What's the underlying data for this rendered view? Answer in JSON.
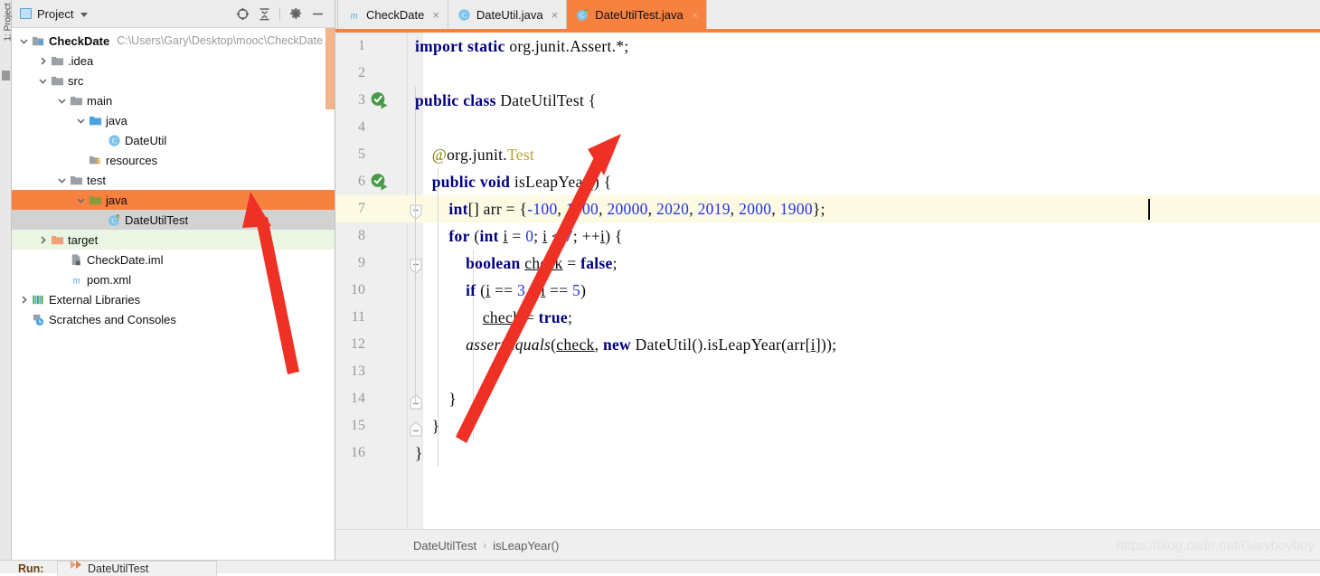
{
  "left_strip": {
    "label": "1: Project"
  },
  "project_panel": {
    "title": "Project",
    "actions": [
      {
        "name": "locate-icon",
        "label": ""
      },
      {
        "name": "collapse-all-icon",
        "label": ""
      },
      {
        "name": "settings-gear-icon",
        "label": ""
      },
      {
        "name": "hide-icon",
        "label": ""
      }
    ],
    "tree": [
      {
        "label": "CheckDate",
        "sub": "C:\\Users\\Gary\\Desktop\\mooc\\CheckDate",
        "depth": 0,
        "arrow": "down",
        "icon": "module-icon",
        "bold": true,
        "state": ""
      },
      {
        "label": ".idea",
        "sub": "",
        "depth": 1,
        "arrow": "right",
        "icon": "folder-gray-icon",
        "bold": false,
        "state": ""
      },
      {
        "label": "src",
        "sub": "",
        "depth": 1,
        "arrow": "down",
        "icon": "folder-gray-icon",
        "bold": false,
        "state": ""
      },
      {
        "label": "main",
        "sub": "",
        "depth": 2,
        "arrow": "down",
        "icon": "folder-gray-icon",
        "bold": false,
        "state": ""
      },
      {
        "label": "java",
        "sub": "",
        "depth": 3,
        "arrow": "down",
        "icon": "folder-blue-icon",
        "bold": false,
        "state": ""
      },
      {
        "label": "DateUtil",
        "sub": "",
        "depth": 4,
        "arrow": "none",
        "icon": "java-class-icon",
        "bold": false,
        "state": ""
      },
      {
        "label": "resources",
        "sub": "",
        "depth": 3,
        "arrow": "none",
        "icon": "folder-resources-icon",
        "bold": false,
        "state": ""
      },
      {
        "label": "test",
        "sub": "",
        "depth": 2,
        "arrow": "down",
        "icon": "folder-gray-icon",
        "bold": false,
        "state": ""
      },
      {
        "label": "java",
        "sub": "",
        "depth": 3,
        "arrow": "down",
        "icon": "folder-green-icon",
        "bold": false,
        "state": "selected-orange"
      },
      {
        "label": "DateUtilTest",
        "sub": "",
        "depth": 4,
        "arrow": "none",
        "icon": "java-test-class-icon",
        "bold": false,
        "state": "selected-gray"
      },
      {
        "label": "target",
        "sub": "",
        "depth": 1,
        "arrow": "right",
        "icon": "folder-orange-icon",
        "bold": false,
        "state": "tint-green"
      },
      {
        "label": "CheckDate.iml",
        "sub": "",
        "depth": 2,
        "arrow": "none",
        "icon": "iml-file-icon",
        "bold": false,
        "state": ""
      },
      {
        "label": "pom.xml",
        "sub": "",
        "depth": 2,
        "arrow": "none",
        "icon": "maven-icon",
        "bold": false,
        "state": ""
      },
      {
        "label": "External Libraries",
        "sub": "",
        "depth": 0,
        "arrow": "right",
        "icon": "libraries-icon",
        "bold": false,
        "state": ""
      },
      {
        "label": "Scratches and Consoles",
        "sub": "",
        "depth": 0,
        "arrow": "none",
        "icon": "scratches-icon",
        "bold": false,
        "state": ""
      }
    ]
  },
  "editor": {
    "tabs": [
      {
        "label": "CheckDate",
        "icon": "maven-icon",
        "active": false,
        "close": "×"
      },
      {
        "label": "DateUtil.java",
        "icon": "java-class-icon",
        "active": false,
        "close": "×"
      },
      {
        "label": "DateUtilTest.java",
        "icon": "java-test-class-icon",
        "active": true,
        "close": "×"
      }
    ],
    "lines": [
      {
        "n": "1",
        "indent": 0
      },
      {
        "n": "2",
        "indent": 0
      },
      {
        "n": "3",
        "indent": 0
      },
      {
        "n": "4",
        "indent": 0
      },
      {
        "n": "5",
        "indent": 0
      },
      {
        "n": "6",
        "indent": 0
      },
      {
        "n": "7",
        "indent": 0
      },
      {
        "n": "8",
        "indent": 0
      },
      {
        "n": "9",
        "indent": 0
      },
      {
        "n": "10",
        "indent": 0
      },
      {
        "n": "11",
        "indent": 0
      },
      {
        "n": "12",
        "indent": 0
      },
      {
        "n": "13",
        "indent": 0
      },
      {
        "n": "14",
        "indent": 0
      },
      {
        "n": "15",
        "indent": 0
      },
      {
        "n": "16",
        "indent": 0
      }
    ],
    "code_text": {
      "l1": "import static org.junit.Assert.*;",
      "l3": "public class DateUtilTest {",
      "l5": "@org.junit.Test",
      "l6": "public void isLeapYear() {",
      "l7": "int[] arr = {-100, 1000, 20000, 2020, 2019, 2000, 1900};",
      "l8": "for (int i = 0; i < 7; ++i) {",
      "l9": "boolean check = false;",
      "l10": "if (i == 3 || i == 5)",
      "l11": "check = true;",
      "l12": "assertEquals(check, new DateUtil().isLeapYear(arr[i]));",
      "l14": "}",
      "l15": "}",
      "l16": "}"
    },
    "highlighted_line": "7",
    "breadcrumb": {
      "class": "DateUtilTest",
      "separator": "›",
      "method": "isLeapYear()"
    },
    "watermark": "https://blog.csdn.net/Garyboyboy"
  },
  "bottom": {
    "run_label": "Run:",
    "run_config": "DateUtilTest"
  },
  "colors": {
    "accent_orange": "#f7813f",
    "selection_gray": "#d2d2d2",
    "line_highlight": "#fdfae4",
    "keyword_navy": "#000080",
    "number_blue": "#2233dd",
    "annotation_olive": "#808000",
    "green_run": "#479a48",
    "arrow_red": "#ee3124"
  }
}
